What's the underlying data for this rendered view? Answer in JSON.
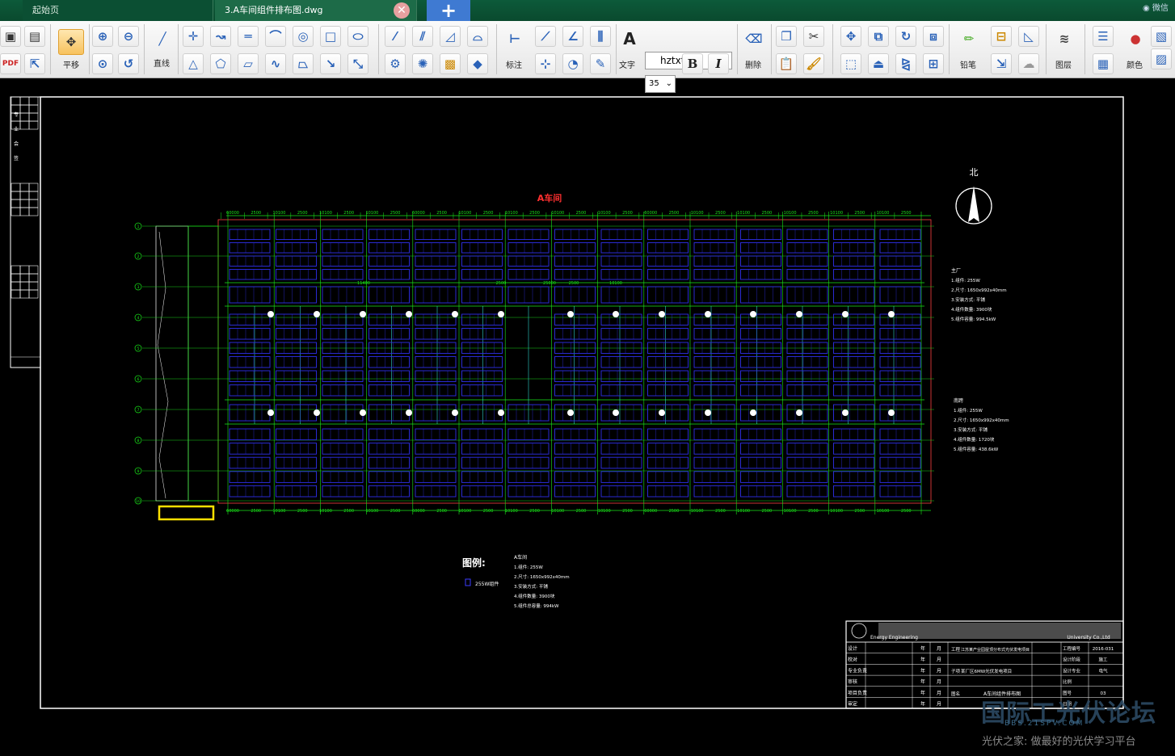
{
  "tabs": {
    "start": "起始页",
    "file": "3.A车间组件排布图.dwg",
    "user_hint": "微信"
  },
  "toolbar": {
    "pan": "平移",
    "line": "直线",
    "dimension": "标注",
    "text": "文字",
    "font": "hztxt",
    "size": "35",
    "bold": "B",
    "italic": "I",
    "erase": "删除",
    "pencil": "铅笔",
    "layer": "图层",
    "color": "颜色"
  },
  "drawing": {
    "north": "北",
    "workshop_title": "A车间",
    "legend_title": "图例:",
    "legend_item": "255W组件",
    "spec_block_title": "A车间",
    "spec_lines": [
      "1.组件: 255W",
      "2.尺寸: 1650x992x40mm",
      "3.安装方式: 平铺",
      "4.组件数量: 3900块",
      "5.组件总容量: 994kW"
    ],
    "note1_title": "主厂",
    "note1_lines": [
      "1.组件: 255W",
      "2.尺寸: 1650x992x40mm",
      "3.安装方式: 平铺",
      "4.组件数量: 3900块",
      "5.组件容量: 994.5kW"
    ],
    "note2_title": "南跨",
    "note2_lines": [
      "1.组件: 255W",
      "2.尺寸: 1650x992x40mm",
      "3.安装方式: 平铺",
      "4.组件数量: 1720块",
      "5.组件容量: 438.6kW"
    ],
    "dim_top": [
      "60000",
      "2500",
      "10100",
      "2500",
      "10100",
      "2500",
      "10100",
      "2500",
      "60000",
      "2500",
      "10100",
      "2500",
      "10100",
      "2500",
      "10100",
      "2500",
      "10100",
      "2500",
      "60000",
      "2500",
      "10100",
      "2500",
      "10100",
      "2500",
      "10100",
      "2500",
      "10100",
      "2500",
      "10100",
      "2500"
    ],
    "dim_mid": [
      "11400",
      "2500",
      "25000",
      "2500",
      "10100"
    ],
    "left_labels": [
      "1",
      "2",
      "3",
      "4",
      "5",
      "6",
      "7",
      "8",
      "9",
      "10"
    ],
    "title_block": {
      "company": "Energy Engineering",
      "company_right": "University Co.,Ltd",
      "project_no_label": "工程编号",
      "project_no": "2016-031",
      "stage_label": "设计阶段",
      "stage": "施工",
      "discipline_label": "设计专业",
      "discipline": "电气",
      "scale_label": "比例",
      "sheet_label": "图号",
      "sheet": "03",
      "date_label": "日期",
      "engineering_label": "工程",
      "engineering": "江苏某产业园屋顶分布式光伏发电项目",
      "subproject_label": "子项",
      "subproject": "某厂区6MW光伏发电项目",
      "drawing_label": "图名",
      "drawing_name": "A车间组件排布图",
      "year": "年",
      "month": "月",
      "roles": [
        "设计",
        "校对",
        "专业负责",
        "审核",
        "项目负责",
        "审定"
      ]
    },
    "side_cells": [
      "专",
      "业",
      "会",
      "签"
    ]
  },
  "watermark": {
    "logo": "国际工光伏论坛",
    "url": "BBS.21SPV.COM",
    "tagline": "光伏之家: 做最好的光伏学习平台"
  }
}
